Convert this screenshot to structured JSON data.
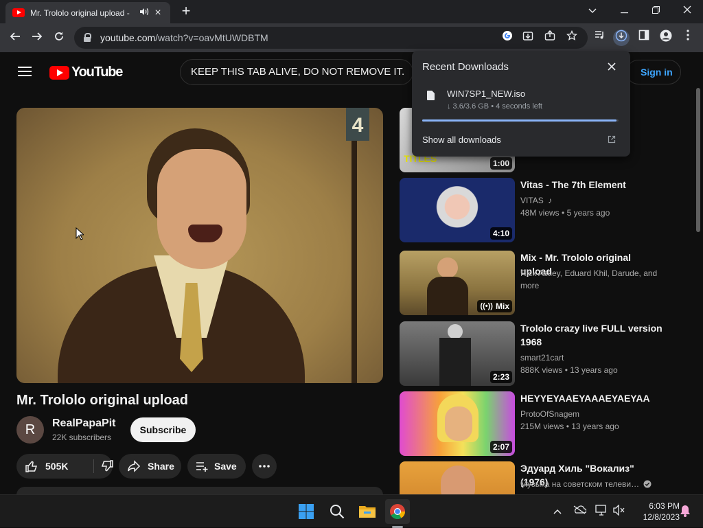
{
  "browser": {
    "tab_title": "Mr. Trololo original upload -",
    "url_host": "youtube.com",
    "url_path": "/watch?v=oavMtUWDBTM",
    "accent_color": "#8ab4f8"
  },
  "youtube": {
    "logo_text": "YouTube",
    "search_value": "KEEP THIS TAB ALIVE,  DO NOT REMOVE IT.",
    "sign_in": "Sign in",
    "brand_color": "#ff0000",
    "player_sign": "4"
  },
  "video": {
    "title": "Mr. Trololo original upload",
    "channel_initial": "R",
    "channel_name": "RealPapaPit",
    "subscribers": "22K subscribers",
    "subscribe_label": "Subscribe",
    "likes": "505K",
    "share_label": "Share",
    "save_label": "Save"
  },
  "downloads": {
    "heading": "Recent Downloads",
    "file_name": "WIN7SP1_NEW.iso",
    "status": "↓ 3.6/3.6 GB • 4 seconds left",
    "progress": 0.99,
    "show_all": "Show all downloads"
  },
  "recommendations": [
    {
      "title": "",
      "duration": "1:00"
    },
    {
      "title": "Vitas - The 7th Element",
      "channel": "VITAS",
      "views": "48M views",
      "age": "5 years ago",
      "duration": "4:10"
    },
    {
      "title": "Mix - Mr. Trololo original upload",
      "channel": "Rick Astley, Eduard Khil, Darude, and more",
      "badge": "Mix"
    },
    {
      "title": "Trololo crazy live FULL version 1968",
      "channel": "smart21cart",
      "views": "888K views",
      "age": "13 years ago",
      "duration": "2:23"
    },
    {
      "title": "HEYYEYAAEYAAAEYAEYAA",
      "channel": "ProtoOfSnagem",
      "views": "215M views",
      "age": "13 years ago",
      "duration": "2:07"
    },
    {
      "title": "Эдуард Хиль \"Вокализ\" (1976)",
      "channel": "Музыка на советском телеви…"
    }
  ],
  "thumb_text": "TITLES",
  "taskbar": {
    "time": "6:03 PM",
    "date": "12/8/2023"
  }
}
